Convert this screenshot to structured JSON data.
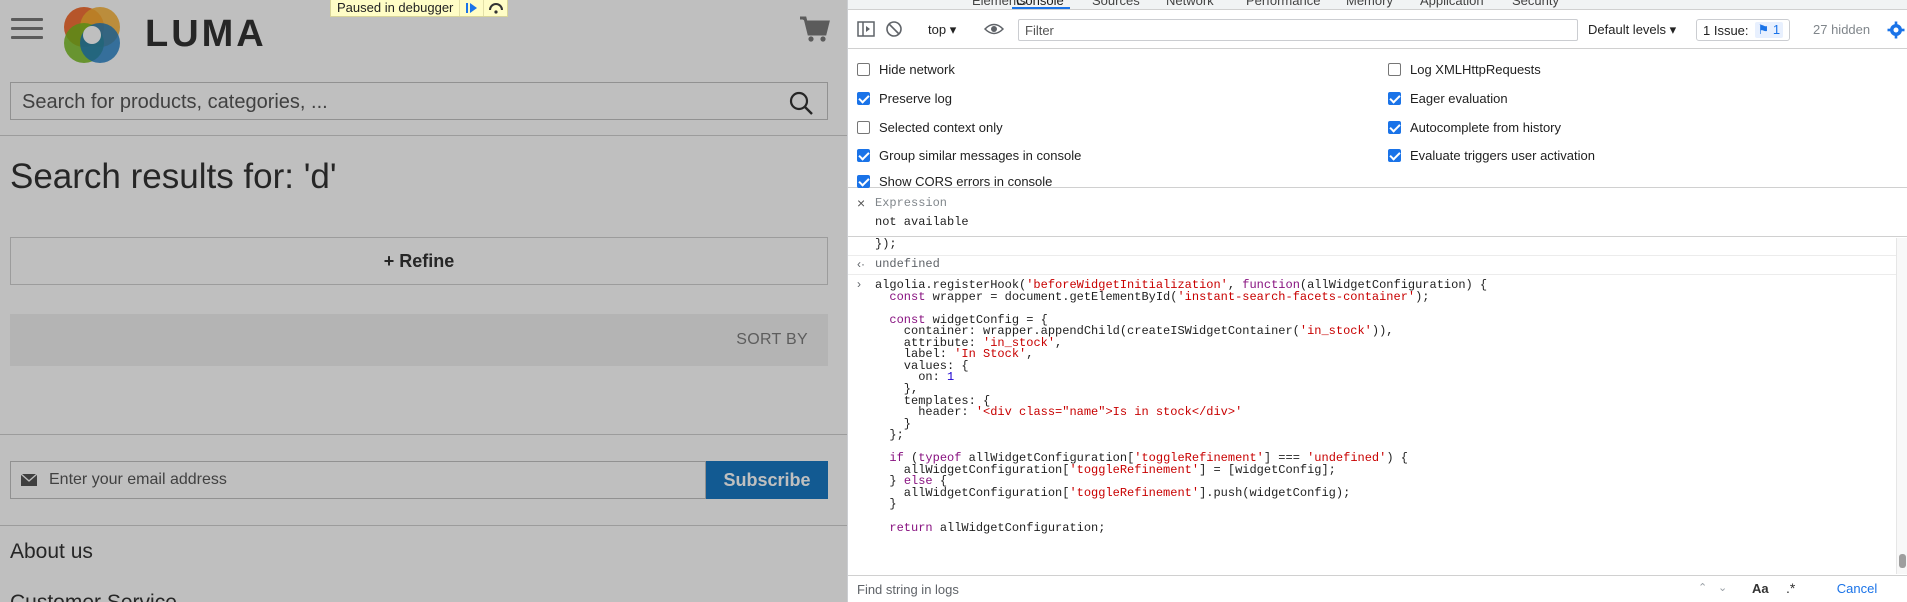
{
  "page": {
    "logo_text": "LUMA",
    "debugger_banner": "Paused in debugger",
    "search_placeholder": "Search for products, categories, ...",
    "title": "Search results for: 'd'",
    "refine_label": "+ Refine",
    "sort_label": "SORT BY",
    "email_placeholder": "Enter your email address",
    "subscribe_label": "Subscribe",
    "about_label": "About us",
    "customer_label": "Customer Service",
    "brand_color": "#1979c3"
  },
  "devtools": {
    "tabs": [
      "Elements",
      "Console",
      "Sources",
      "Network",
      "Performance",
      "Memory",
      "Application",
      "Security"
    ],
    "active_tab": "Console",
    "context": "top",
    "filter_placeholder": "Filter",
    "levels": "Default levels",
    "issues_label": "1 Issue:",
    "issues_count": "1",
    "hidden_label": "27 hidden",
    "settings_left": [
      {
        "label": "Hide network",
        "checked": false
      },
      {
        "label": "Preserve log",
        "checked": true
      },
      {
        "label": "Selected context only",
        "checked": false
      },
      {
        "label": "Group similar messages in console",
        "checked": true
      },
      {
        "label": "Show CORS errors in console",
        "checked": true
      }
    ],
    "settings_right": [
      {
        "label": "Log XMLHttpRequests",
        "checked": false
      },
      {
        "label": "Eager evaluation",
        "checked": true
      },
      {
        "label": "Autocomplete from history",
        "checked": true
      },
      {
        "label": "Evaluate triggers user activation",
        "checked": true
      }
    ],
    "watch": {
      "expression_placeholder": "Expression",
      "value": "not available"
    },
    "console": {
      "prev_line": "});",
      "undefined_output": "undefined",
      "code_lines": [
        "algolia.registerHook('beforeWidgetInitialization', function(allWidgetConfiguration) {",
        "  const wrapper = document.getElementById('instant-search-facets-container');",
        "",
        "  const widgetConfig = {",
        "    container: wrapper.appendChild(createISWidgetContainer('in_stock')),",
        "    attribute: 'in_stock',",
        "    label: 'In Stock',",
        "    values: {",
        "      on: 1",
        "    },",
        "    templates: {",
        "      header: '<div class=\"name\">Is in stock</div>'",
        "    }",
        "  };",
        "",
        "  if (typeof allWidgetConfiguration['toggleRefinement'] === 'undefined') {",
        "    allWidgetConfiguration['toggleRefinement'] = [widgetConfig];",
        "  } else {",
        "    allWidgetConfiguration['toggleRefinement'].push(widgetConfig);",
        "  }",
        "",
        "  return allWidgetConfiguration;"
      ]
    },
    "find": {
      "placeholder": "Find string in logs",
      "match_case": "Aa",
      "regex": ".*",
      "cancel": "Cancel"
    }
  }
}
